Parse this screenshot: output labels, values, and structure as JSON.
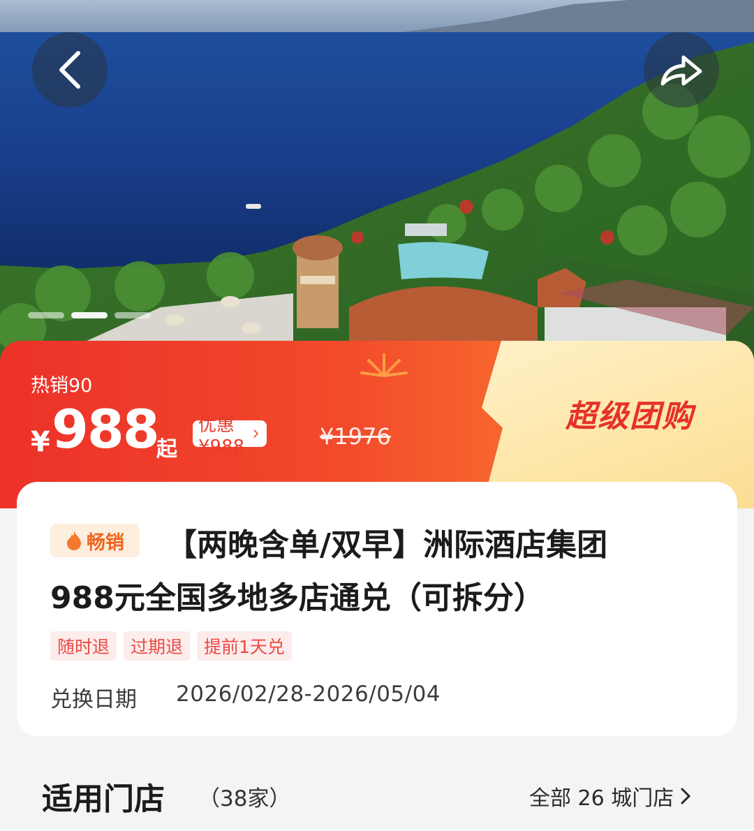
{
  "header": {
    "back_icon": "chevron-left-icon",
    "share_icon": "share-arrow-icon",
    "image_pager": {
      "count": 3,
      "active_index": 1
    }
  },
  "price_banner": {
    "hot_sale": "热销90",
    "currency": "¥",
    "price": "988",
    "price_suffix": "起",
    "discount": "优惠¥988",
    "original_price": "¥1976",
    "promo_label": "超级团购",
    "colors": {
      "red": "#ec3129",
      "yellow": "#fde6a6",
      "promo_text": "#e6312a"
    }
  },
  "product": {
    "badge": "畅销",
    "badge_icon": "flame-icon",
    "title_line1": "【两晚含单/双早】洲际酒店集团",
    "title_line2": "988元全国多地多店通兑（可拆分）",
    "tags": [
      "随时退",
      "过期退",
      "提前1天兑"
    ],
    "date_label": "兑换日期",
    "date_range": "2026/02/28-2026/05/04"
  },
  "stores": {
    "title": "适用门店",
    "count": "（38家）",
    "all_link": "全部 26 城门店"
  }
}
